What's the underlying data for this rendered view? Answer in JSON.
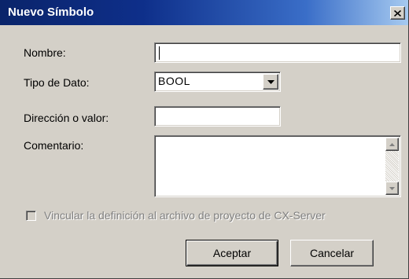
{
  "window": {
    "title": "Nuevo Símbolo",
    "close_icon": "close-x-icon"
  },
  "form": {
    "nombre": {
      "label": "Nombre:",
      "value": ""
    },
    "tipo_dato": {
      "label": "Tipo de Dato:",
      "value": "BOOL",
      "icon": "dropdown-arrow-icon"
    },
    "direccion": {
      "label": "Dirección o valor:",
      "value": ""
    },
    "comentario": {
      "label": "Comentario:",
      "value": ""
    }
  },
  "checkbox": {
    "label": "Vincular la definición al archivo de proyecto de CX-Server",
    "checked": false,
    "enabled": false
  },
  "buttons": {
    "ok_label": "Aceptar",
    "cancel_label": "Cancelar"
  },
  "colors": {
    "title_start": "#0a246a",
    "title_end": "#a6caf0",
    "face": "#d4d0c8",
    "disabled_text": "#808080"
  }
}
